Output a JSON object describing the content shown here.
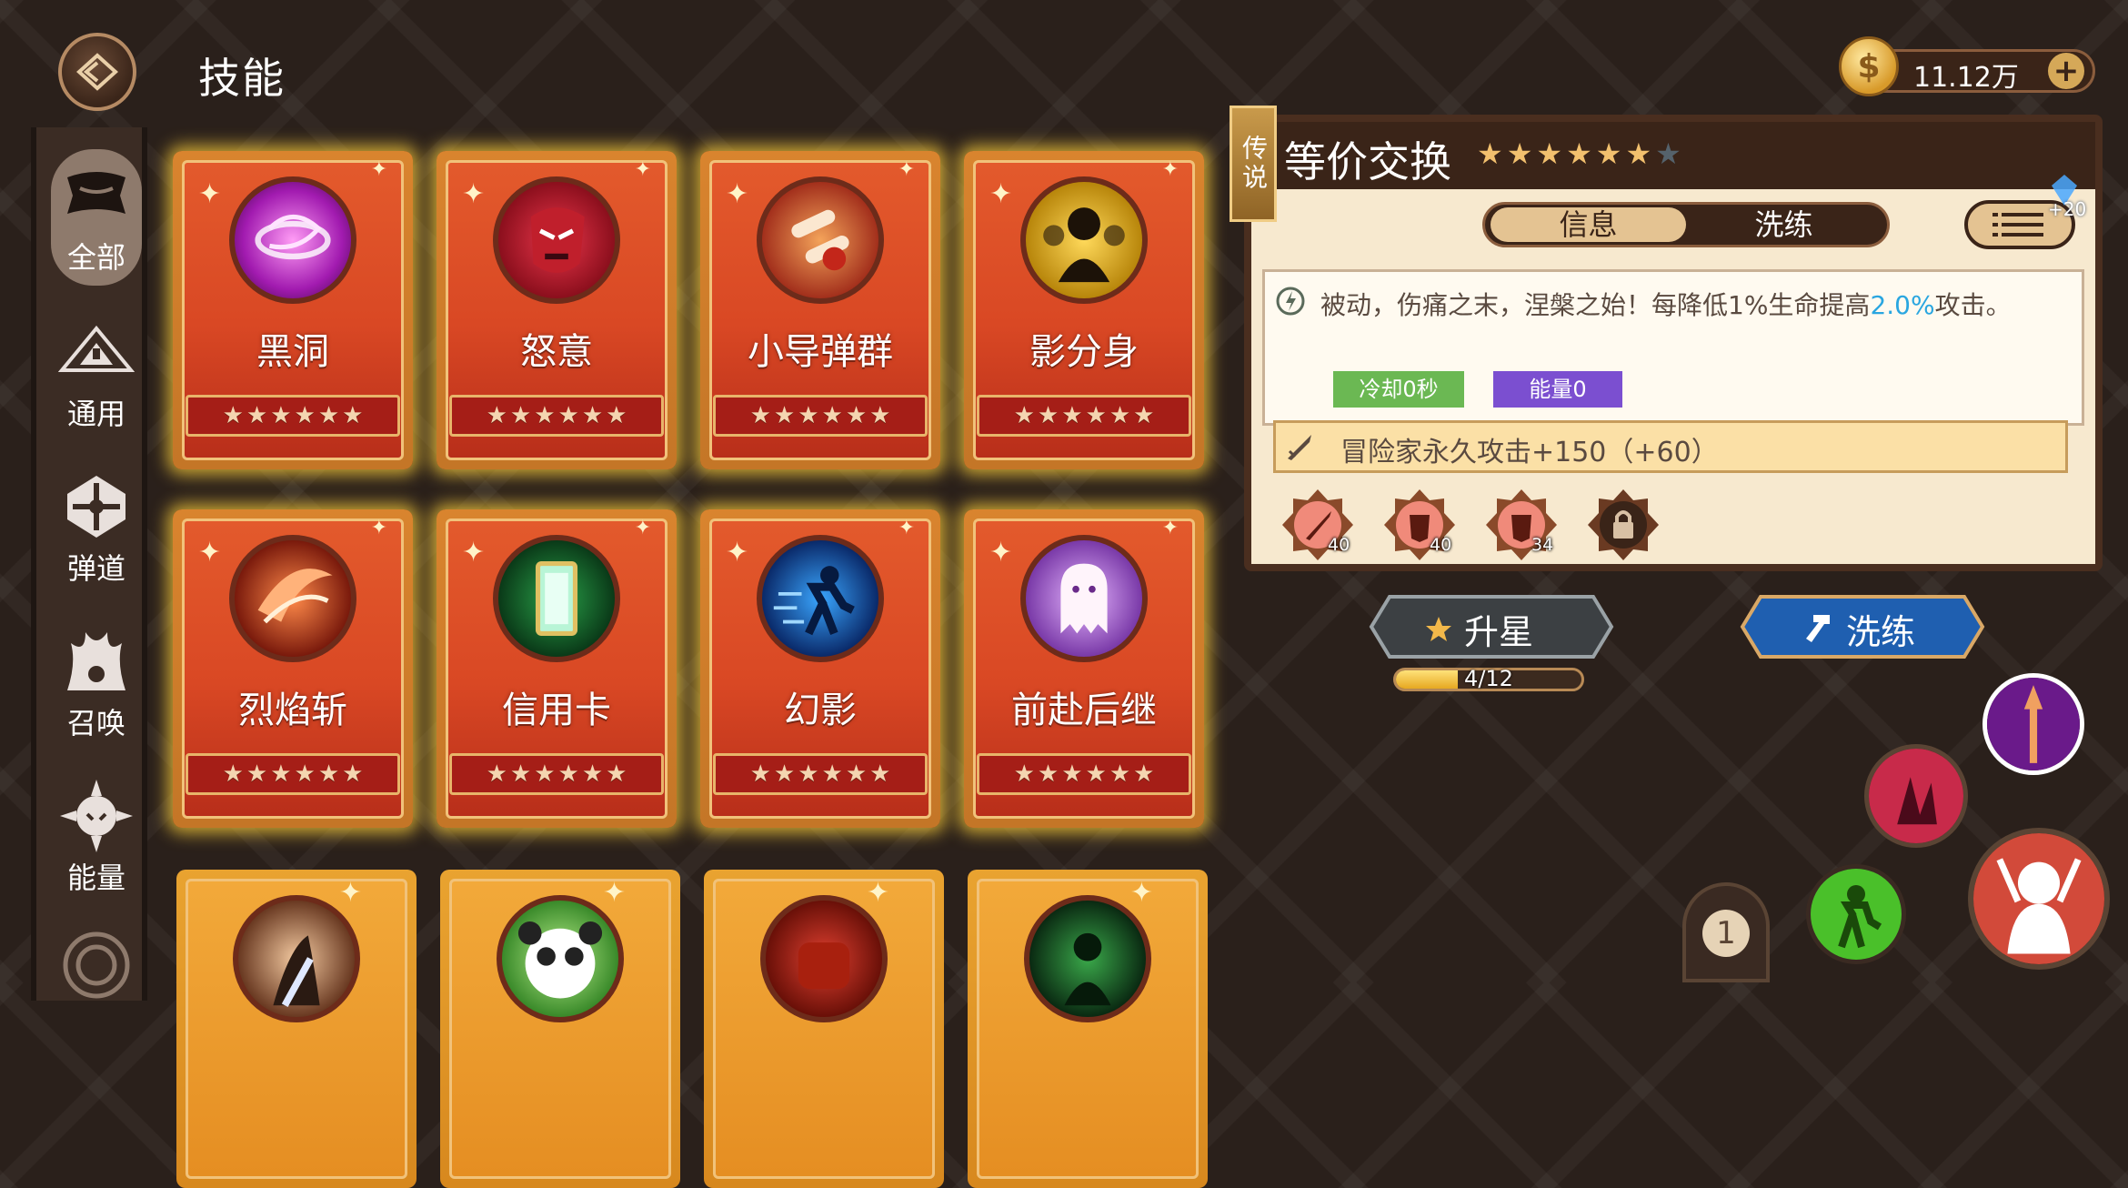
{
  "header": {
    "title": "技能"
  },
  "currency": {
    "amount": "11.12万"
  },
  "sidebar": {
    "items": [
      {
        "label": "全部",
        "icon": "all-skills-icon",
        "active": true
      },
      {
        "label": "通用",
        "icon": "general-icon",
        "active": false
      },
      {
        "label": "弹道",
        "icon": "projectile-icon",
        "active": false
      },
      {
        "label": "召唤",
        "icon": "summon-icon",
        "active": false
      },
      {
        "label": "能量",
        "icon": "energy-icon",
        "active": false
      }
    ]
  },
  "skills": [
    {
      "name": "黑洞",
      "icon": "black-hole-icon",
      "stars": 6
    },
    {
      "name": "怒意",
      "icon": "rage-icon",
      "stars": 6
    },
    {
      "name": "小导弹群",
      "icon": "missiles-icon",
      "stars": 6
    },
    {
      "name": "影分身",
      "icon": "shadow-clone-icon",
      "stars": 6
    },
    {
      "name": "烈焰斩",
      "icon": "flame-slash-icon",
      "stars": 6
    },
    {
      "name": "信用卡",
      "icon": "credit-card-icon",
      "stars": 6
    },
    {
      "name": "幻影",
      "icon": "phantom-icon",
      "stars": 6
    },
    {
      "name": "前赴后继",
      "icon": "ghost-icon",
      "stars": 6
    }
  ],
  "detail": {
    "rarity": "传说",
    "name": "等价交换",
    "stars_filled": 6,
    "stars_total": 7,
    "tabs": [
      "信息",
      "洗练"
    ],
    "active_tab": "信息",
    "list_badge": "+20",
    "description_main": "被动，伤痛之末，涅槃之始！每降低1%生命提高",
    "description_highlight": "2.0%",
    "description_end": "攻击。",
    "cooldown": "冷却0秒",
    "energy": "能量0",
    "bonus": "冒险家永久攻击+150（+60）",
    "runes": [
      {
        "icon": "sword-rune-icon",
        "level": "40"
      },
      {
        "icon": "armor-rune-icon",
        "level": "40"
      },
      {
        "icon": "armor-rune-icon",
        "level": "34"
      },
      {
        "icon": "lock-icon",
        "level": ""
      }
    ]
  },
  "actions": {
    "upstar_label": "升星",
    "upstar_progress_text": "4/12",
    "upstar_progress": 0.3333,
    "refine_label": "洗练"
  },
  "page_indicator": "1"
}
